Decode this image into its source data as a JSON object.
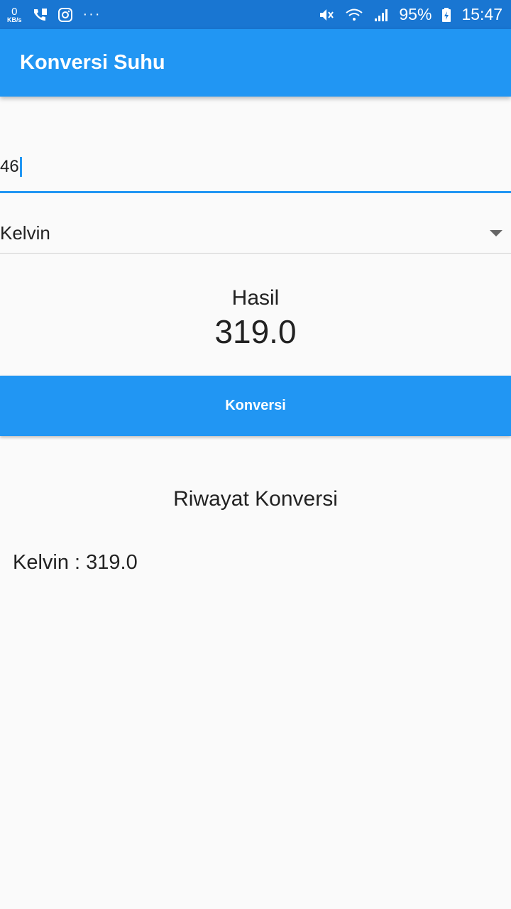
{
  "status_bar": {
    "data_speed": "0",
    "data_unit": "KB/s",
    "overflow": "···",
    "battery": "95%",
    "time": "15:47"
  },
  "app_bar": {
    "title": "Konversi Suhu"
  },
  "input": {
    "value": "46"
  },
  "dropdown": {
    "selected": "Kelvin"
  },
  "result": {
    "label": "Hasil",
    "value": "319.0"
  },
  "convert_button": {
    "label": "Konversi"
  },
  "history": {
    "title": "Riwayat Konversi",
    "items": [
      "Kelvin : 319.0"
    ]
  },
  "colors": {
    "status_bar": "#1976d2",
    "primary": "#2196f3",
    "background": "#fafafa"
  }
}
